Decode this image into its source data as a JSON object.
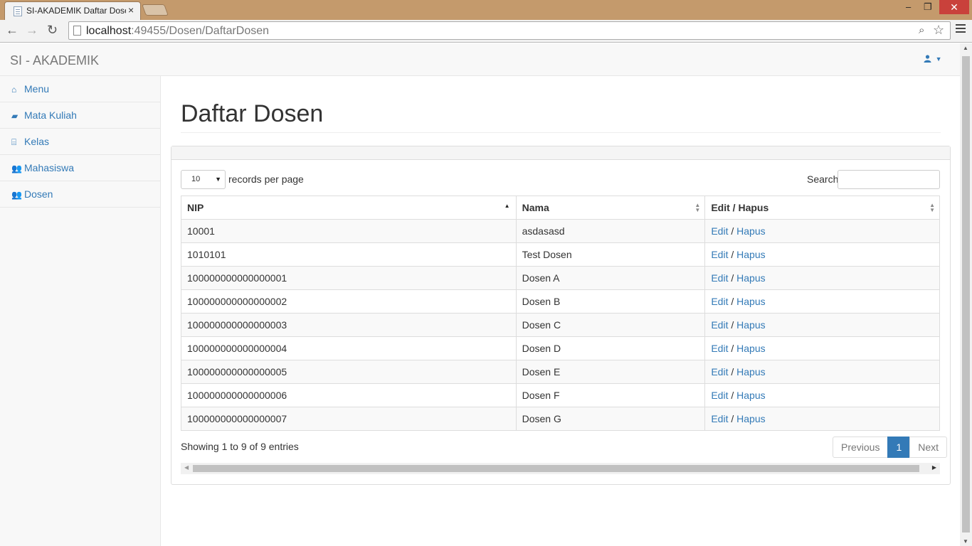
{
  "browser": {
    "tab_title": "SI-AKADEMIK Daftar Dose",
    "tab_close": "×",
    "url_host": "localhost",
    "url_rest": ":49455/Dosen/DaftarDosen",
    "win_min": "–",
    "win_max": "❐",
    "win_close": "✕"
  },
  "navbar": {
    "brand": "SI - AKADEMIK",
    "user_icon": "user-icon"
  },
  "sidebar": {
    "items": [
      {
        "label": "Menu",
        "icon": "home-icon"
      },
      {
        "label": "Mata Kuliah",
        "icon": "book-icon"
      },
      {
        "label": "Kelas",
        "icon": "institution-icon"
      },
      {
        "label": "Mahasiswa",
        "icon": "users-icon"
      },
      {
        "label": "Dosen",
        "icon": "users-icon"
      }
    ]
  },
  "main": {
    "title": "Daftar Dosen",
    "length_value": "10",
    "length_label": "records per page",
    "search_label": "Search:",
    "search_value": "",
    "columns": [
      "NIP",
      "Nama",
      "Edit / Hapus"
    ],
    "rows": [
      {
        "nip": "10001",
        "nama": "asdasasd"
      },
      {
        "nip": "1010101",
        "nama": "Test Dosen"
      },
      {
        "nip": "100000000000000001",
        "nama": "Dosen A"
      },
      {
        "nip": "100000000000000002",
        "nama": "Dosen B"
      },
      {
        "nip": "100000000000000003",
        "nama": "Dosen C"
      },
      {
        "nip": "100000000000000004",
        "nama": "Dosen D"
      },
      {
        "nip": "100000000000000005",
        "nama": "Dosen E"
      },
      {
        "nip": "100000000000000006",
        "nama": "Dosen F"
      },
      {
        "nip": "100000000000000007",
        "nama": "Dosen G"
      }
    ],
    "edit_label": "Edit",
    "separator": " / ",
    "delete_label": "Hapus",
    "info": "Showing 1 to 9 of 9 entries",
    "pager": {
      "previous": "Previous",
      "current": "1",
      "next": "Next"
    }
  },
  "colors": {
    "link": "#337ab7",
    "active_page": "#337ab7"
  }
}
